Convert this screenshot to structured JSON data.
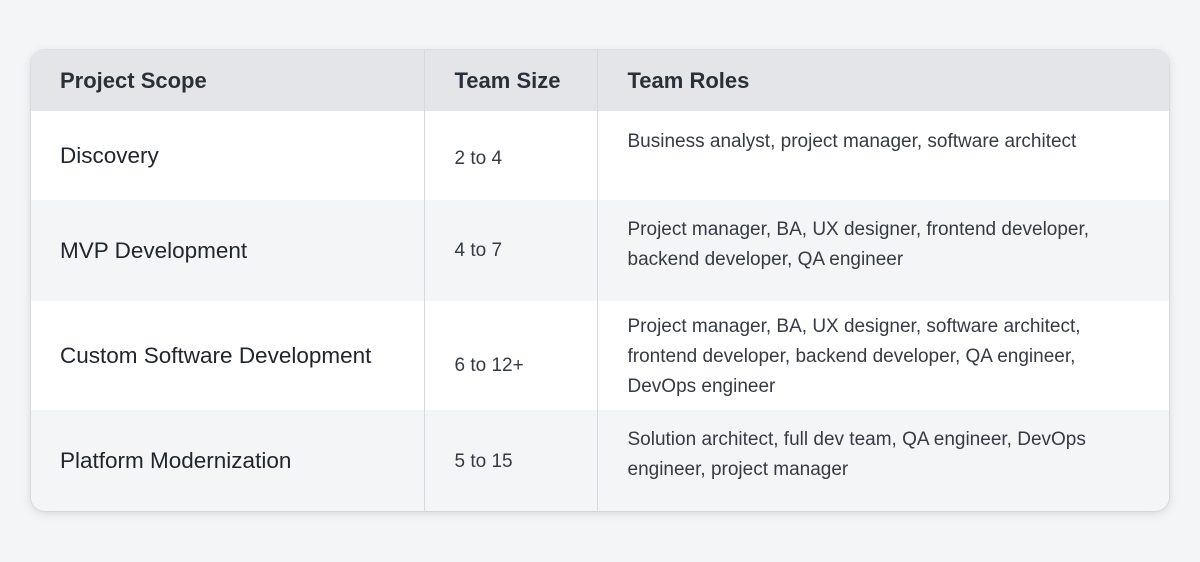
{
  "table": {
    "headers": {
      "scope": "Project Scope",
      "size": "Team Size",
      "roles": "Team Roles"
    },
    "rows": [
      {
        "scope": "Discovery",
        "size": "2 to 4",
        "roles": "Business analyst, project manager, software architect"
      },
      {
        "scope": "MVP Development",
        "size": "4 to 7",
        "roles": "Project manager, BA, UX designer, frontend developer, backend developer, QA engineer"
      },
      {
        "scope": "Custom Software Development",
        "size": "6 to 12+",
        "roles": "Project manager, BA, UX designer, software architect, frontend developer, backend developer, QA engineer, DevOps engineer"
      },
      {
        "scope": "Platform Modernization",
        "size": "5 to 15",
        "roles": "Solution architect, full dev team, QA engineer, DevOps engineer, project manager"
      }
    ]
  },
  "colors": {
    "page_background": "#f4f5f7",
    "header_background": "#e3e5e8",
    "stripe_background": "#f4f5f7",
    "text": "#20262e"
  }
}
